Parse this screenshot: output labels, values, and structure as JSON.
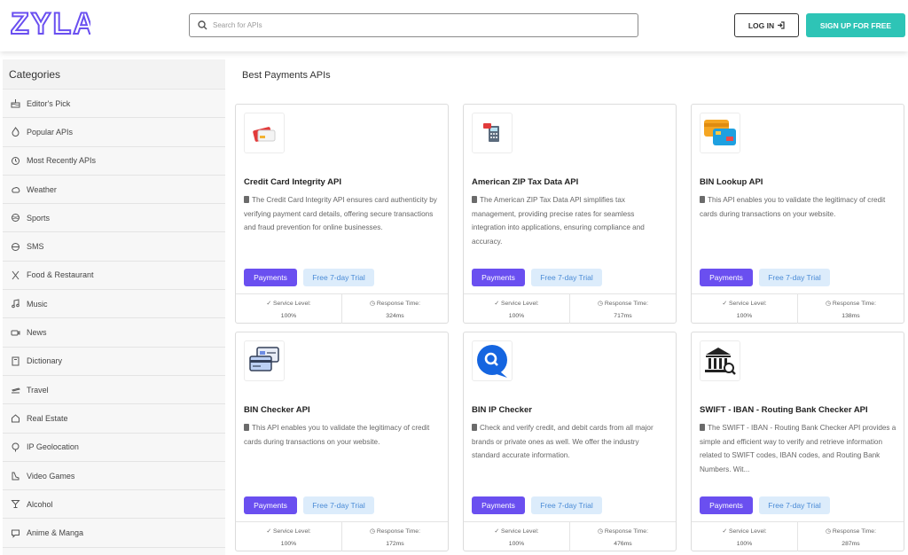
{
  "header": {
    "logo_text": "ZYLA",
    "search_placeholder": "Search for APIs",
    "login_label": "LOG IN",
    "signup_label": "SIGN UP FOR FREE"
  },
  "sidebar": {
    "title": "Categories",
    "items": [
      {
        "label": "Editor's Pick",
        "icon": "cake-icon"
      },
      {
        "label": "Popular APIs",
        "icon": "flame-icon"
      },
      {
        "label": "Most Recently APIs",
        "icon": "history-icon"
      },
      {
        "label": "Weather",
        "icon": "weather-icon"
      },
      {
        "label": "Sports",
        "icon": "ball-icon"
      },
      {
        "label": "SMS",
        "icon": "sms-icon"
      },
      {
        "label": "Food & Restaurant",
        "icon": "utensils-icon"
      },
      {
        "label": "Music",
        "icon": "music-icon"
      },
      {
        "label": "News",
        "icon": "news-icon"
      },
      {
        "label": "Dictionary",
        "icon": "book-icon"
      },
      {
        "label": "Travel",
        "icon": "plane-icon"
      },
      {
        "label": "Real Estate",
        "icon": "house-icon"
      },
      {
        "label": "IP Geolocation",
        "icon": "map-pin-icon"
      },
      {
        "label": "Video Games",
        "icon": "gamepad-icon"
      },
      {
        "label": "Alcohol",
        "icon": "cocktail-icon"
      },
      {
        "label": "Anime & Manga",
        "icon": "comment-icon"
      }
    ]
  },
  "main": {
    "title": "Best Payments APIs",
    "stat_labels": {
      "service": "Service Level:",
      "response": "Response Time:"
    },
    "tag_category": "Payments",
    "tag_trial": "Free 7-day Trial",
    "cards": [
      {
        "name": "Credit Card Integrity API",
        "desc": "The Credit Card Integrity API ensures card authenticity by verifying payment card details, offering secure transactions and fraud prevention for online businesses.",
        "service": "100%",
        "response": "324ms",
        "icon": "credit-card-icon"
      },
      {
        "name": "American ZIP Tax Data API",
        "desc": "The American ZIP Tax Data API simplifies tax management, providing precise rates for seamless integration into applications, ensuring compliance and accuracy.",
        "service": "100%",
        "response": "717ms",
        "icon": "tax-calculator-icon"
      },
      {
        "name": "BIN Lookup API",
        "desc": "This API enables you to validate the legitimacy of credit cards during transactions on your website.",
        "service": "100%",
        "response": "138ms",
        "icon": "cards-icon"
      },
      {
        "name": "BIN Checker API",
        "desc": "This API enables you to validate the legitimacy of credit cards during transactions on your website.",
        "service": "100%",
        "response": "172ms",
        "icon": "card-checker-icon"
      },
      {
        "name": "BIN IP Checker",
        "desc": "Check and verify credit, and debit cards from all major brands or private ones as well. We offer the industry standard accurate information.",
        "service": "100%",
        "response": "476ms",
        "icon": "search-bubble-icon"
      },
      {
        "name": "SWIFT - IBAN - Routing Bank Checker API",
        "desc": "The SWIFT - IBAN - Routing Bank Checker API provides a simple and efficient way to verify and retrieve information related to SWIFT codes, IBAN codes, and Routing Bank Numbers. Wit...",
        "service": "100%",
        "response": "287ms",
        "icon": "bank-search-icon"
      }
    ]
  },
  "colors": {
    "accent": "#6a4ff0",
    "signup": "#2ec4b6",
    "trial_bg": "#dcecfb",
    "logo": "#6a4ff0"
  }
}
